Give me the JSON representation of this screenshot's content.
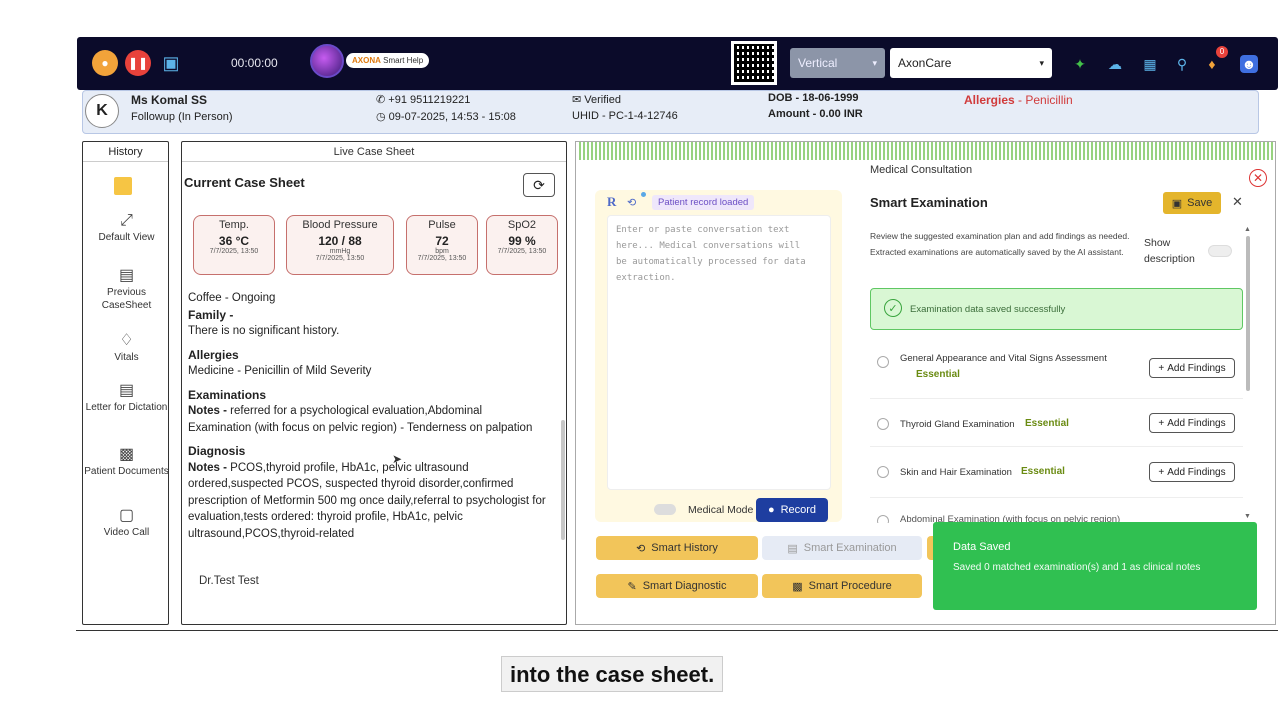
{
  "topbar": {
    "timer": "00:00:00",
    "axona_brand": "AXONA",
    "axona_label": "Smart Help",
    "vertical_select": "Vertical",
    "org_select": "AxonCare",
    "notification_count": "0",
    "colors": {
      "bg": "#0b0b2a",
      "mic": "#f2a33a",
      "pause": "#e8423b",
      "save": "#5cb3e8"
    }
  },
  "patient": {
    "initial": "K",
    "name": "Ms Komal SS",
    "visit_type": "Followup (In Person)",
    "phone": "+91 9511219221",
    "datetime": "09-07-2025, 14:53 - 15:08",
    "email_status": "Verified",
    "uhid": "UHID - PC-1-4-12746",
    "dob": "DOB - 18-06-1999",
    "amount": "Amount - 0.00 INR",
    "allergies_label": "Allergies",
    "allergies_value": " - Penicillin"
  },
  "history": {
    "title": "History",
    "items": [
      {
        "label": "Default View"
      },
      {
        "label": "Previous CaseSheet"
      },
      {
        "label": "Vitals"
      },
      {
        "label": "Letter for Dictation"
      },
      {
        "label": "Patient Documents"
      },
      {
        "label": "Video Call"
      }
    ]
  },
  "live": {
    "title": "Live Case Sheet",
    "sheet_title": "Current Case Sheet",
    "vitals": [
      {
        "label": "Temp.",
        "value": "36 °C",
        "unit": "",
        "date": "7/7/2025, 13:50"
      },
      {
        "label": "Blood Pressure",
        "value": "120 / 88",
        "unit": "mmHg",
        "date": "7/7/2025, 13:50"
      },
      {
        "label": "Pulse",
        "value": "72",
        "unit": "bpm",
        "date": "7/7/2025, 13:50"
      },
      {
        "label": "SpO2",
        "value": "99 %",
        "unit": "",
        "date": "7/7/2025, 13:50"
      }
    ],
    "coffee": "Coffee - Ongoing",
    "family_label": "Family -",
    "family_text": "There is no significant history.",
    "allergies_title": "Allergies",
    "allergies_text": "Medicine - Penicillin of Mild Severity",
    "exam_title": "Examinations",
    "exam_notes_label": "Notes -",
    "exam_notes": " referred for a psychological evaluation,Abdominal Examination (with focus on pelvic region) - Tenderness on palpation",
    "diag_title": "Diagnosis",
    "diag_notes_label": "Notes -",
    "diag_notes": " PCOS,thyroid profile, HbA1c, pelvic ultrasound ordered,suspected PCOS, suspected thyroid disorder,confirmed prescription of Metformin 500 mg once daily,referral to psychologist for evaluation,tests ordered: thyroid profile, HbA1c, pelvic ultrasound,PCOS,thyroid-related",
    "doctor": "Dr.Test Test"
  },
  "consult": {
    "title": "Medical Consultation",
    "patient_record_loaded": "Patient record loaded",
    "placeholder": "Enter or paste conversation text here... Medical conversations will be automatically processed for data extraction.",
    "medical_mode": "Medical Mode",
    "record": "Record",
    "smart_exam_title": "Smart Examination",
    "save": "Save",
    "description": "Review the suggested examination plan and add findings as needed. Extracted examinations are automatically saved by the AI assistant.",
    "show_description": "Show description",
    "success_msg": "Examination data saved successfully",
    "exams": [
      {
        "name": "General Appearance and Vital Signs Assessment",
        "badge": "Essential",
        "action": "Add Findings"
      },
      {
        "name": "Thyroid Gland Examination",
        "badge": "Essential",
        "action": "Add Findings"
      },
      {
        "name": "Skin and Hair Examination",
        "badge": "Essential",
        "action": "Add Findings"
      },
      {
        "name": "Abdominal Examination (with focus on pelvic region)",
        "badge": "",
        "action": ""
      }
    ],
    "buttons": {
      "smart_history": "Smart History",
      "smart_examination": "Smart Examination",
      "smart_diagnostic": "Smart Diagnostic",
      "smart_procedure": "Smart Procedure"
    }
  },
  "toast": {
    "title": "Data Saved",
    "message": "Saved 0 matched examination(s) and 1 as clinical notes"
  },
  "caption": "into the case sheet."
}
